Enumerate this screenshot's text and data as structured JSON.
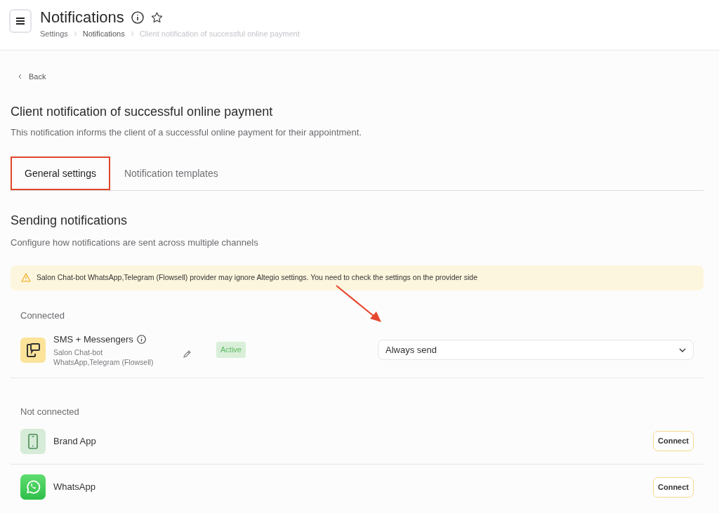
{
  "header": {
    "title": "Notifications",
    "breadcrumbs": [
      "Settings",
      "Notifications",
      "Client notification of successful online payment"
    ]
  },
  "back": "Back",
  "page": {
    "title": "Client notification of successful online payment",
    "description": "This notification informs the client of a successful online payment for their appointment."
  },
  "tabs": [
    {
      "label": "General settings",
      "selected": true,
      "highlighted": true
    },
    {
      "label": "Notification templates",
      "selected": false,
      "highlighted": false
    }
  ],
  "section": {
    "title": "Sending notifications",
    "description": "Configure how notifications are sent across multiple channels"
  },
  "warning": "Salon Chat-bot WhatsApp,Telegram (Flowsell) provider may ignore Altegio settings. You need to check the settings on the provider side",
  "connected": {
    "heading": "Connected",
    "channels": [
      {
        "kind": "sms",
        "name": "SMS + Messengers",
        "provider": [
          "Salon Chat-bot",
          "WhatsApp,Telegram (Flowsell)"
        ],
        "status": "Active",
        "send_mode": "Always send",
        "arrow_pointed": true
      }
    ]
  },
  "not_connected": {
    "heading": "Not connected",
    "channels": [
      {
        "kind": "app",
        "name": "Brand App",
        "action": "Connect"
      },
      {
        "kind": "whatsapp",
        "name": "WhatsApp",
        "action": "Connect"
      }
    ]
  }
}
